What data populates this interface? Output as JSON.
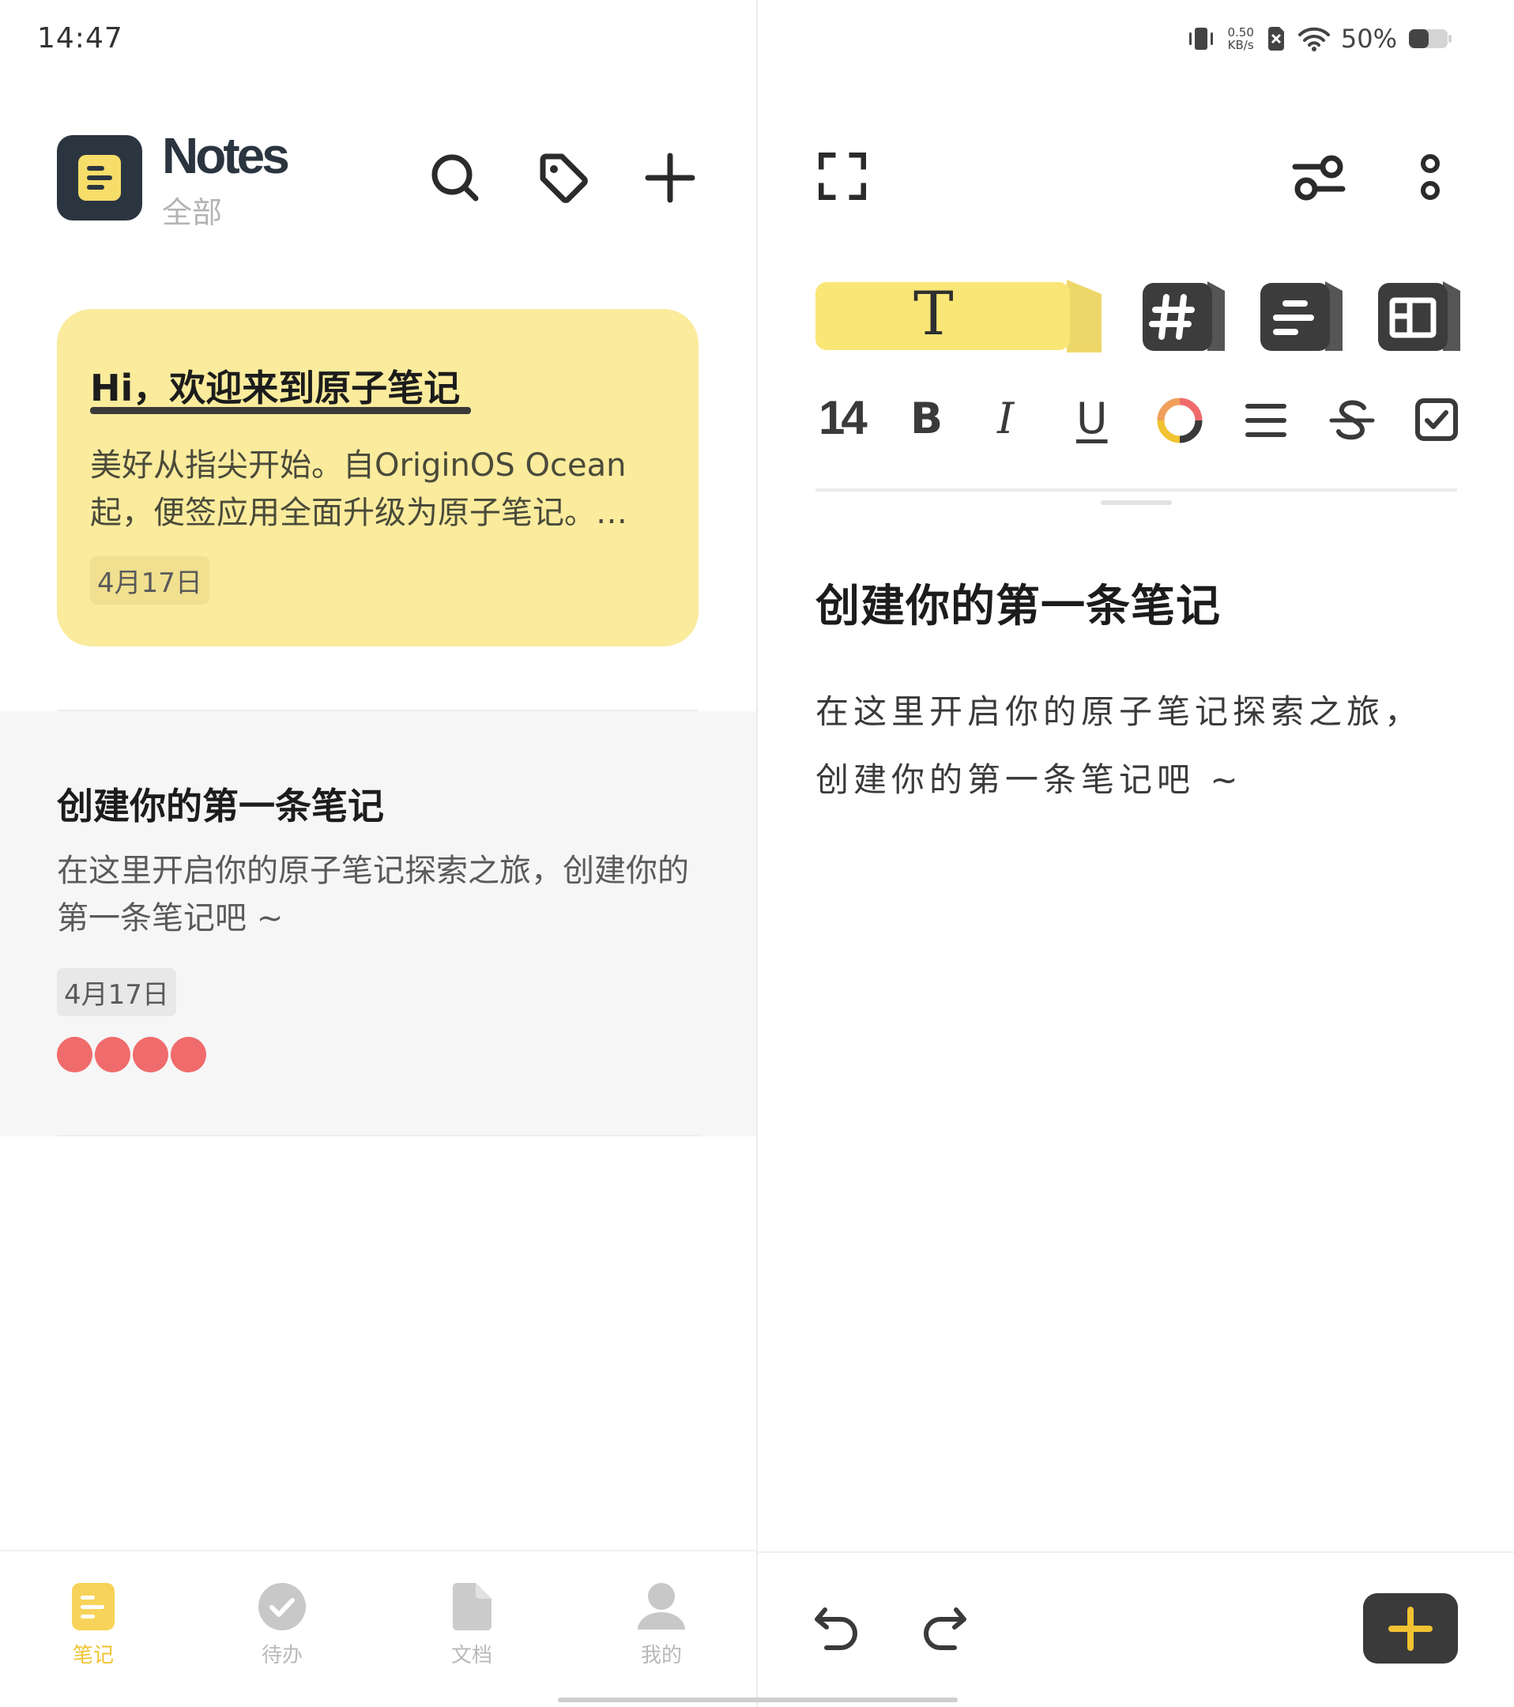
{
  "status": {
    "time": "14:47",
    "speed_value": "0.50",
    "speed_unit": "KB/s",
    "battery": "50%",
    "battery_level": 0.5
  },
  "header": {
    "app_title": "Notes",
    "folder": "全部",
    "icons": [
      "search-icon",
      "tag-icon",
      "add-icon"
    ]
  },
  "notes": [
    {
      "title": "Hi，欢迎来到原子笔记",
      "preview": "美好从指尖开始。自OriginOS Ocean起，便签应用全面升级为原子笔记。…",
      "date": "4月17日",
      "color": "#faeb9d"
    },
    {
      "title": "创建你的第一条笔记",
      "preview": "在这里开启你的原子笔记探索之旅，创建你的第一条笔记吧 ~",
      "date": "4月17日",
      "dot_color": "#f06b6b",
      "dots": 4
    }
  ],
  "bottom_nav": [
    {
      "label": "笔记",
      "icon": "note-icon",
      "active": true
    },
    {
      "label": "待办",
      "icon": "check-circle-icon",
      "active": false
    },
    {
      "label": "文档",
      "icon": "document-icon",
      "active": false
    },
    {
      "label": "我的",
      "icon": "profile-icon",
      "active": false
    }
  ],
  "editor": {
    "toolbar_icons": [
      "fullscreen-icon",
      "settings-sliders-icon",
      "more-icon"
    ],
    "style_buttons": [
      "text-style-icon",
      "hashtag-icon",
      "paragraph-icon",
      "layout-icon"
    ],
    "text_style_glyph": "T",
    "font_size": "14",
    "format_bold": "B",
    "format_italic": "I",
    "format_underline": "U",
    "format_icons": [
      "color-ring-icon",
      "align-icon",
      "strikethrough-icon",
      "checkbox-icon"
    ],
    "note_title": "创建你的第一条笔记",
    "note_body_line1": "在这里开启你的原子笔记探索之旅，",
    "note_body_line2": "创建你的第一条笔记吧 ~",
    "bottom_icons": [
      "undo-icon",
      "redo-icon",
      "add-icon"
    ],
    "accent": "#f1c232"
  }
}
